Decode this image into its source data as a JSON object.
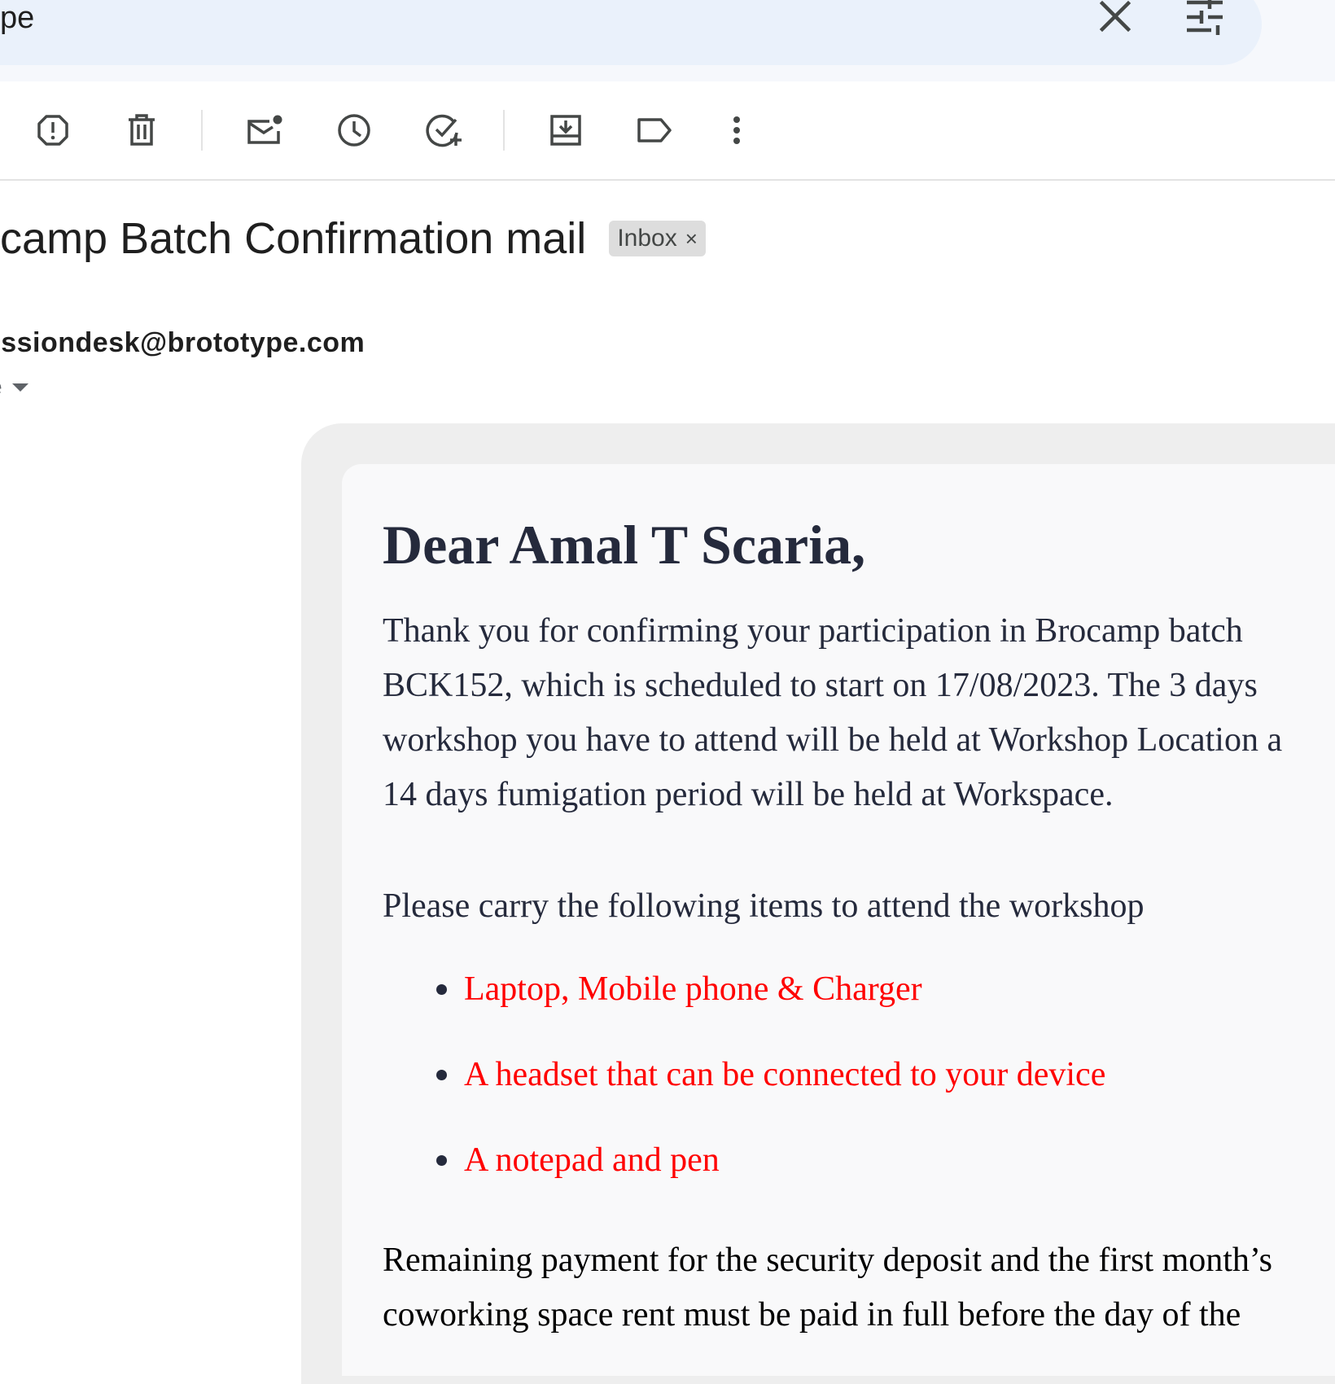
{
  "search": {
    "query": "pe",
    "clear_icon": "close-icon",
    "filters_icon": "tune-icon"
  },
  "toolbar": {
    "icons": [
      "report-spam-icon",
      "delete-icon",
      "mark-unread-icon",
      "snooze-icon",
      "add-to-tasks-icon",
      "move-to-icon",
      "labels-icon",
      "more-vert-icon"
    ]
  },
  "email": {
    "subject": "ocamp Batch Confirmation mail",
    "label": "Inbox",
    "label_close": "×",
    "sender": "nissiondesk@brototype.com",
    "recipient": "e",
    "greeting": "Dear Amal T Scaria,",
    "intro_lines": [
      "Thank you for confirming your participation in Brocamp batch",
      "BCK152, which is scheduled to start on 17/08/2023. The 3 days",
      "workshop you have to attend will be held at Workshop Location a",
      "14 days fumigation period will be held at Workspace."
    ],
    "items_intro": "Please carry the following items to attend the workshop",
    "items": [
      "Laptop, Mobile phone & Charger",
      "A headset that can be connected to your device",
      "A notepad and pen"
    ],
    "payment_lines": [
      "Remaining payment for the security deposit and the first month’s",
      "coworking space rent must be paid in full before the day of the"
    ],
    "item_color": "#ff0000",
    "text_color": "#252a3c"
  }
}
